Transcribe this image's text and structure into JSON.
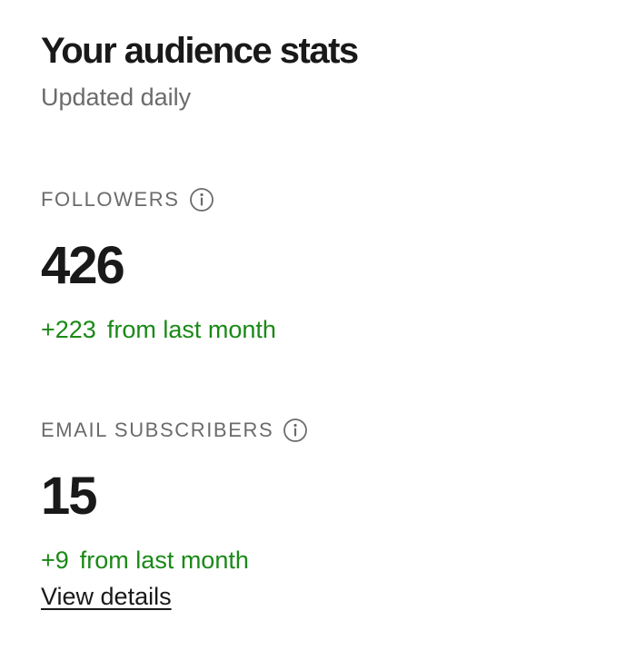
{
  "header": {
    "title": "Your audience stats",
    "subtitle": "Updated daily"
  },
  "stats": [
    {
      "label": "FOLLOWERS",
      "icon": "info-icon",
      "value": "426",
      "delta": "+223",
      "delta_text": "from last month"
    },
    {
      "label": "EMAIL SUBSCRIBERS",
      "icon": "info-icon",
      "value": "15",
      "delta": "+9",
      "delta_text": "from last month",
      "link_label": "View details"
    }
  ],
  "colors": {
    "text_primary": "#191919",
    "text_secondary": "#6b6b6b",
    "positive_change": "#1a8917"
  }
}
